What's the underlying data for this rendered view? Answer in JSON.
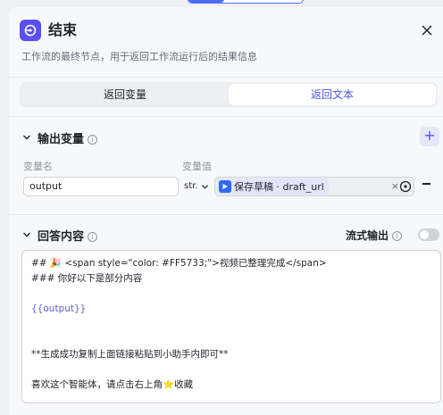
{
  "node": {
    "title": "结束",
    "description": "工作流的最终节点，用于返回工作流运行后的结果信息"
  },
  "tabs": [
    {
      "label": "返回变量",
      "active": false
    },
    {
      "label": "返回文本",
      "active": true
    }
  ],
  "output_section": {
    "title": "输出变量",
    "col_name": "变量名",
    "col_value": "变量值",
    "row": {
      "name": "output",
      "type": "str.",
      "ref_label": "保存草稿 · draft_url"
    }
  },
  "answer_section": {
    "title": "回答内容",
    "stream_label": "流式输出",
    "stream_on": false,
    "lines": [
      "## 🎉 <span style=\"color: #FF5733;\">视频已整理完成</span>",
      "### 你好以下是部分内容",
      "",
      "{{output}}",
      "",
      "",
      "**生成成功复制上面链接粘贴到小助手内即可**",
      "",
      "喜欢这个智能体，请点击右上角⭐收藏"
    ]
  },
  "colors": {
    "accent": "#4d53e8",
    "node_icon": "#5a4ff5"
  }
}
